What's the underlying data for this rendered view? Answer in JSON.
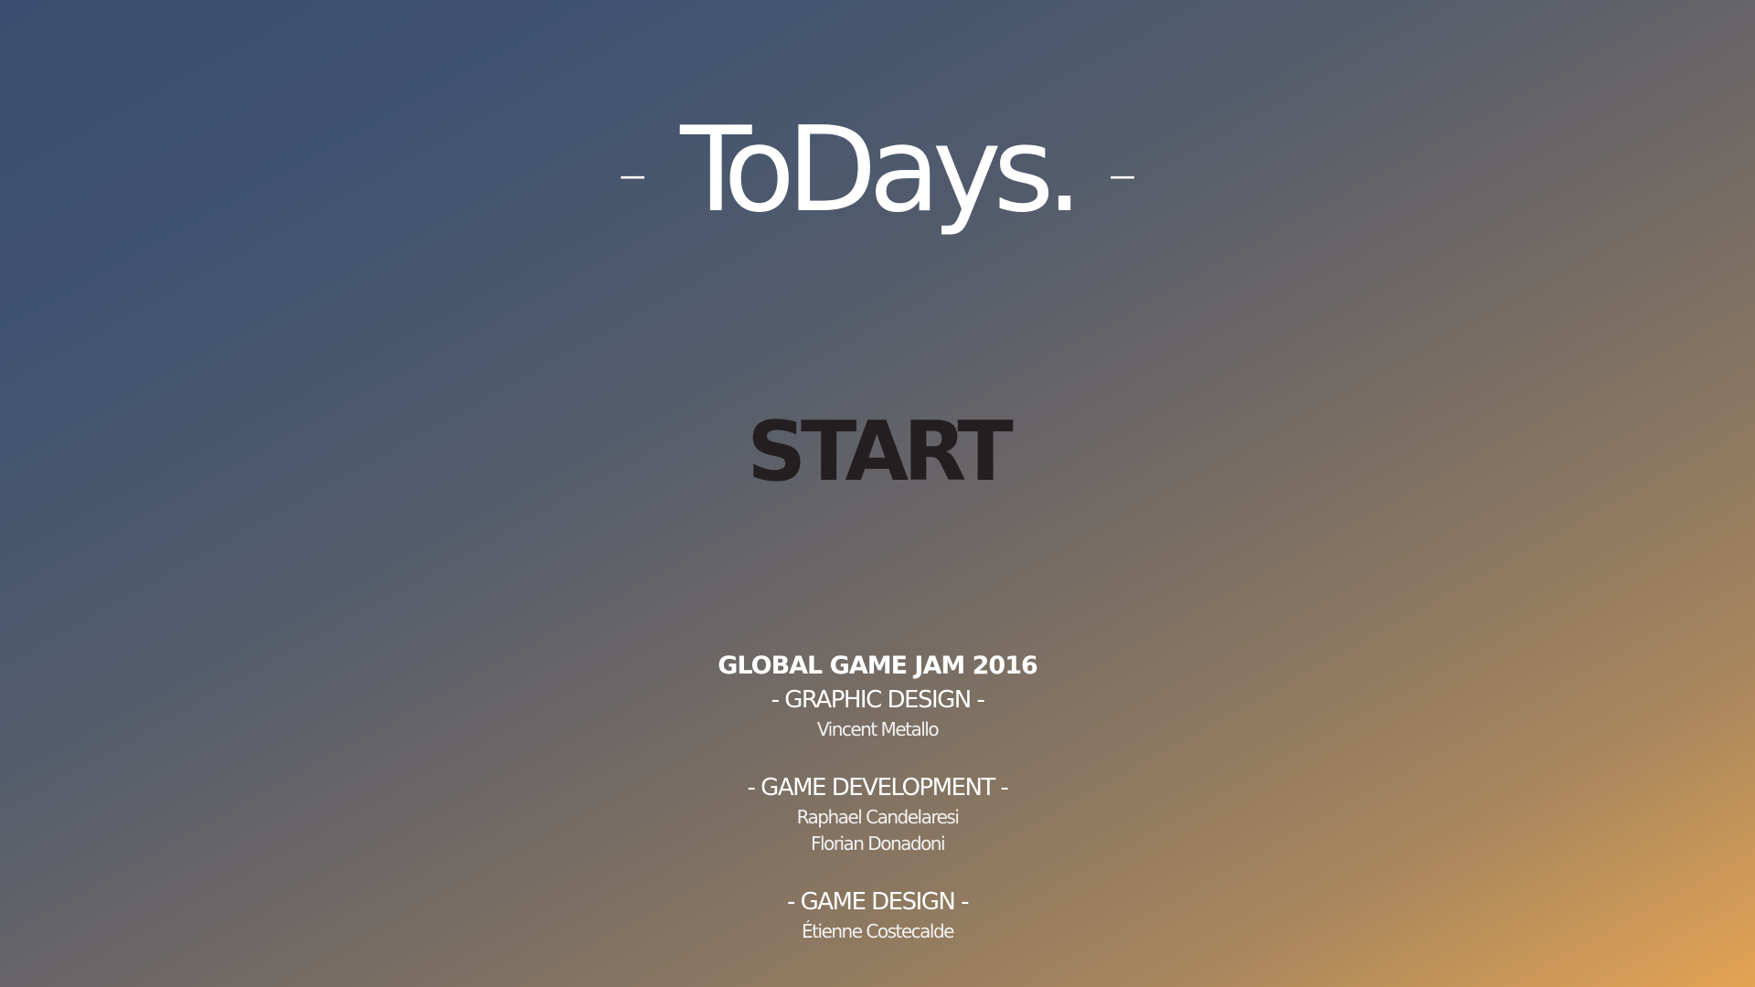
{
  "title": {
    "left_dash": "–",
    "text": "ToDays.",
    "right_dash": "–"
  },
  "menu": {
    "start_label": "START"
  },
  "credits": {
    "event": "GLOBAL GAME JAM 2016",
    "sections": [
      {
        "heading": "- GRAPHIC DESIGN -",
        "names": [
          "Vincent Metallo"
        ]
      },
      {
        "heading": "- GAME DEVELOPMENT -",
        "names": [
          "Raphael Candelaresi",
          "Florian Donadoni"
        ]
      },
      {
        "heading": "- GAME DESIGN -",
        "names": [
          "Étienne Costecalde"
        ]
      }
    ]
  },
  "colors": {
    "gradient_start": "#3a4f6f",
    "gradient_end": "#e3a354",
    "start_text": "#231f20",
    "text": "#ffffff"
  }
}
